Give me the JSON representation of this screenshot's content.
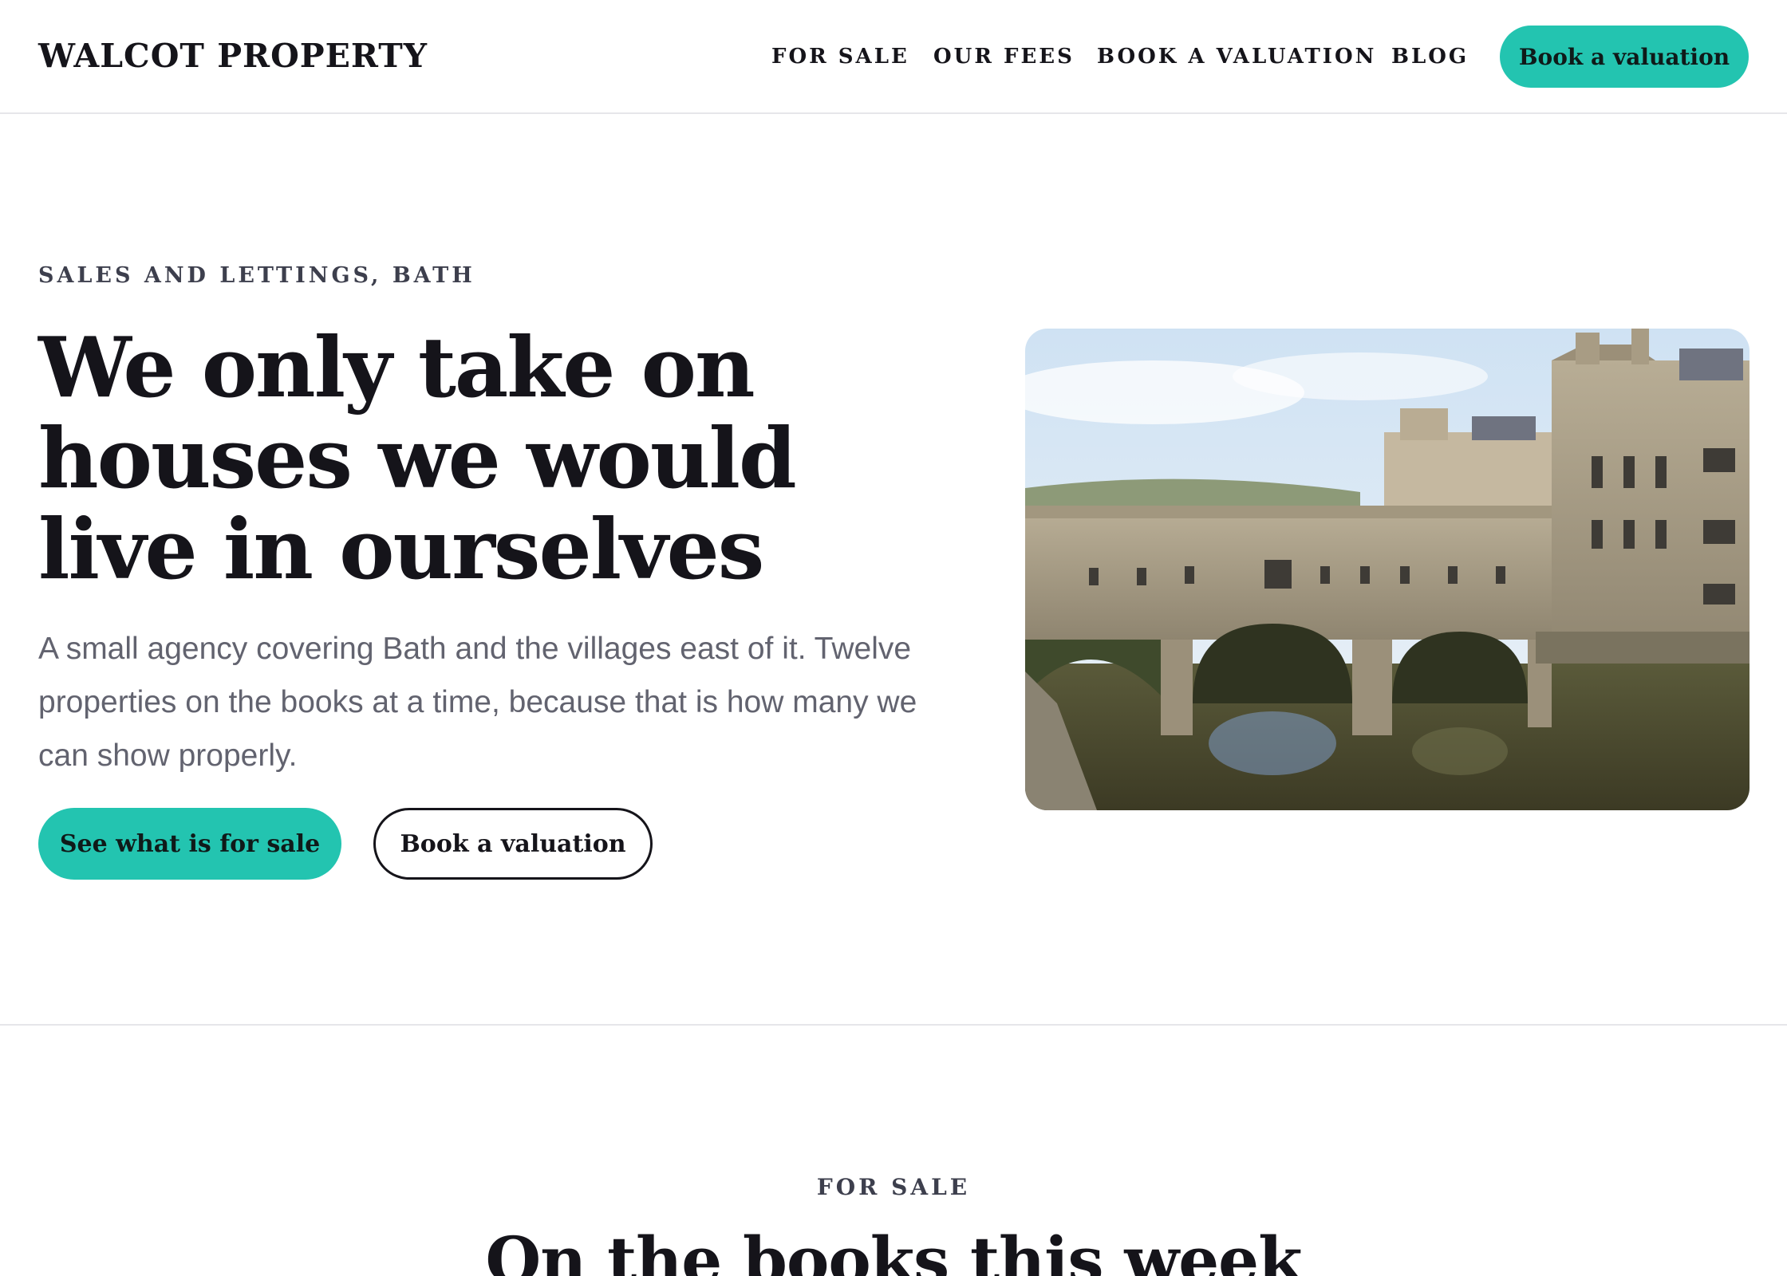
{
  "header": {
    "brand": "WALCOT PROPERTY",
    "nav": [
      "FOR SALE",
      "OUR FEES",
      "BOOK A VALUATION",
      "BLOG"
    ],
    "cta_label": "Book a valuation"
  },
  "hero": {
    "eyebrow": "SALES AND LETTINGS, BATH",
    "title": "We only take on houses we would live in ourselves",
    "lede": "A small agency covering Bath and the villages east of it. Twelve properties on the books at a time, because that is how many we can show properly.",
    "primary_button": "See what is for sale",
    "secondary_button": "Book a valuation"
  },
  "for_sale": {
    "eyebrow": "FOR SALE",
    "title": "On the books this week"
  },
  "colors": {
    "accent": "#23c4b0",
    "text": "#15141a",
    "muted": "#62636f"
  }
}
